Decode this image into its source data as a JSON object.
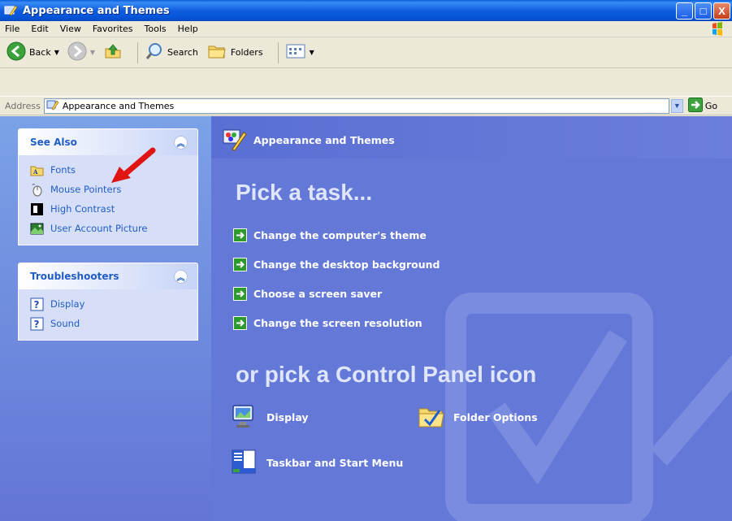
{
  "window": {
    "title": "Appearance and Themes",
    "buttons": {
      "minimize": "_",
      "maximize": "□",
      "close": "X"
    }
  },
  "menu": [
    "File",
    "Edit",
    "View",
    "Favorites",
    "Tools",
    "Help"
  ],
  "toolbar": {
    "back_label": "Back",
    "search_label": "Search",
    "folders_label": "Folders"
  },
  "address": {
    "label": "Address",
    "value": "Appearance and Themes",
    "go_label": "Go"
  },
  "see_also": {
    "title": "See Also",
    "items": [
      {
        "label": "Fonts",
        "icon": "fonts-folder-icon"
      },
      {
        "label": "Mouse Pointers",
        "icon": "mouse-icon"
      },
      {
        "label": "High Contrast",
        "icon": "high-contrast-icon"
      },
      {
        "label": "User Account Picture",
        "icon": "user-picture-icon"
      }
    ]
  },
  "troubleshooters": {
    "title": "Troubleshooters",
    "items": [
      {
        "label": "Display",
        "icon": "help-icon"
      },
      {
        "label": "Sound",
        "icon": "help-icon"
      }
    ]
  },
  "main": {
    "title": "Appearance and Themes",
    "pick_task": "Pick a task...",
    "tasks": [
      "Change the computer's theme",
      "Change the desktop background",
      "Choose a screen saver",
      "Change the screen resolution"
    ],
    "pick_icon": "or pick a Control Panel icon",
    "icons": [
      {
        "label": "Display",
        "icon": "display-icon"
      },
      {
        "label": "Folder Options",
        "icon": "folder-options-icon"
      },
      {
        "label": "Taskbar and Start Menu",
        "icon": "taskbar-icon"
      }
    ]
  },
  "colors": {
    "title_bar": "#0553d6",
    "link_blue": "#215dc6",
    "task_pane": "#6478d8",
    "green_arrow": "#2c9b2c",
    "annotation_arrow": "#e11414"
  }
}
